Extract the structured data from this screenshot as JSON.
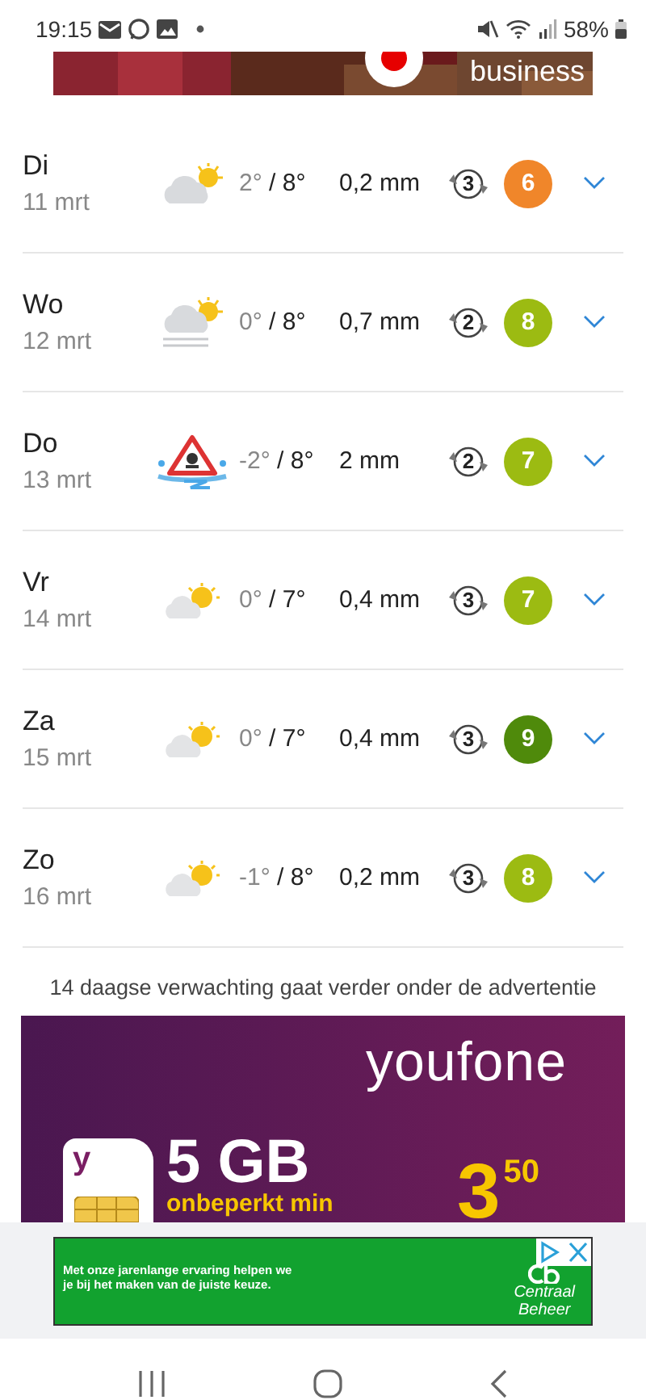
{
  "status_bar": {
    "time": "19:15",
    "battery": "58%"
  },
  "top_banner": {
    "kind": "picture",
    "caption": "business"
  },
  "days": [
    {
      "day": "Di",
      "date": "11 mrt",
      "kind": "partly-cloudy",
      "low": "2°",
      "separator": "/",
      "high": "8°",
      "precip": "0,2 mm",
      "wind": "3",
      "score": "6",
      "color": "#f0862a",
      "expanded": false
    },
    {
      "day": "Wo",
      "date": "12 mrt",
      "kind": "fog",
      "low": "0°",
      "separator": "/",
      "high": "8°",
      "precip": "0,7 mm",
      "wind": "2",
      "score": "8",
      "color": "#9cbb12",
      "expanded": false
    },
    {
      "day": "Do",
      "date": "13 mrt",
      "kind": "slippery",
      "low": "-2°",
      "separator": "/",
      "high": "8°",
      "precip": "2 mm",
      "wind": "2",
      "score": "7",
      "color": "#9cbb12",
      "expanded": false
    },
    {
      "day": "Vr",
      "date": "14 mrt",
      "kind": "sun-cloud",
      "low": "0°",
      "separator": "/",
      "high": "7°",
      "precip": "0,4 mm",
      "wind": "3",
      "score": "7",
      "color": "#9cbb12",
      "expanded": false
    },
    {
      "day": "Za",
      "date": "15 mrt",
      "kind": "sun-cloud",
      "low": "0°",
      "separator": "/",
      "high": "7°",
      "precip": "0,4 mm",
      "wind": "3",
      "score": "9",
      "color": "#4f8a0b",
      "expanded": false
    },
    {
      "day": "Zo",
      "date": "16 mrt",
      "kind": "sun-cloud",
      "low": "-1°",
      "separator": "/",
      "high": "8°",
      "precip": "0,2 mm",
      "wind": "3",
      "score": "8",
      "color": "#9cbb12",
      "expanded": false
    }
  ],
  "notice": "14 daagse verwachting gaat verder onder de advertentie",
  "ad": {
    "brand": "youfone",
    "data": "5 GB",
    "subtitle": "onbeperkt min",
    "price": "3",
    "cents": "50",
    "sim_letter": "y"
  },
  "bottom_ad": {
    "lines": [
      "Met onze jarenlange ervaring helpen we",
      "je bij het maken van de juiste keuze."
    ],
    "brand_lines": [
      "Centraal",
      "Beheer"
    ]
  }
}
